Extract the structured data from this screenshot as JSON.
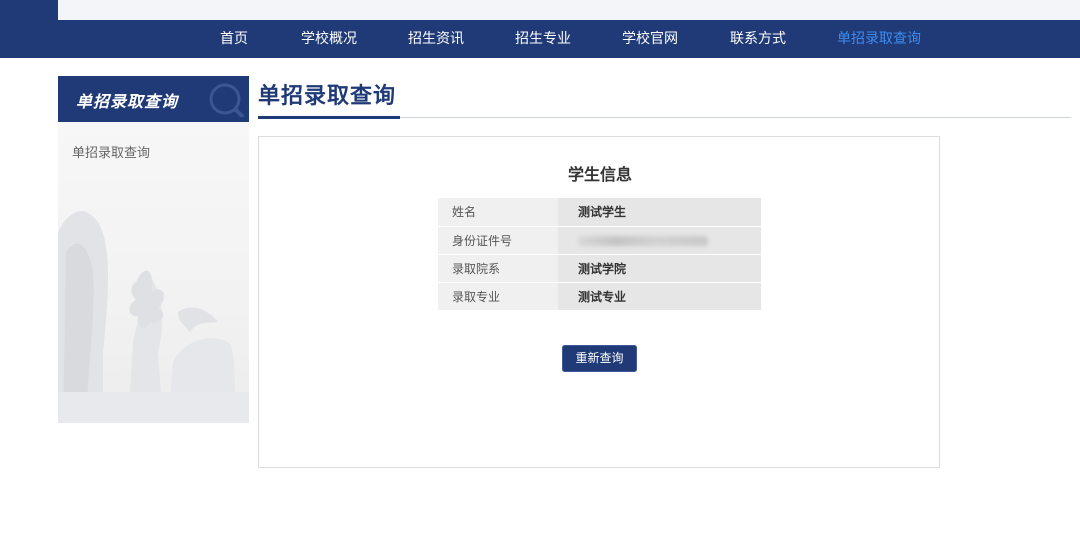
{
  "nav": {
    "items": [
      {
        "label": "首页"
      },
      {
        "label": "学校概况"
      },
      {
        "label": "招生资讯"
      },
      {
        "label": "招生专业"
      },
      {
        "label": "学校官网"
      },
      {
        "label": "联系方式"
      },
      {
        "label": "单招录取查询",
        "active": true
      }
    ]
  },
  "sidebar": {
    "header": "单招录取查询",
    "links": [
      {
        "label": "单招录取查询"
      }
    ]
  },
  "main": {
    "title": "单招录取查询",
    "panel": {
      "title": "学生信息",
      "rows": [
        {
          "key": "姓名",
          "value": "测试学生"
        },
        {
          "key": "身份证件号",
          "value": ""
        },
        {
          "key": "录取院系",
          "value": "测试学院"
        },
        {
          "key": "录取专业",
          "value": "测试专业"
        }
      ],
      "requery_label": "重新查询"
    }
  },
  "colors": {
    "brand": "#1f3a77",
    "active_nav": "#3d8cf0"
  }
}
